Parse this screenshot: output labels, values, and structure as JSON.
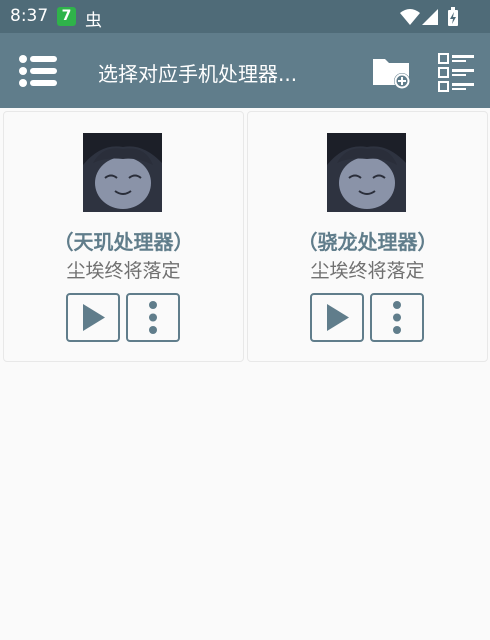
{
  "status_bar": {
    "time": "8:37",
    "badge_text": "7",
    "app_glyph": "虫",
    "icons": [
      "wifi-icon",
      "signal-icon",
      "battery-charging-icon"
    ]
  },
  "toolbar": {
    "title": "选择对应手机处理器...",
    "menu_icon": "menu-list-icon",
    "folder_icon": "folder-add-icon",
    "list_icon": "checklist-icon"
  },
  "cards": [
    {
      "title": "（天玑处理器）",
      "subtitle": "尘埃终将落定",
      "play_icon": "play-icon",
      "more_icon": "more-vertical-icon"
    },
    {
      "title": "（骁龙处理器）",
      "subtitle": "尘埃终将落定",
      "play_icon": "play-icon",
      "more_icon": "more-vertical-icon"
    }
  ],
  "colors": {
    "status_bar": "#4f6b78",
    "toolbar": "#607d8b",
    "accent": "#607d8b",
    "badge": "#2fb34a",
    "background": "#fafafa"
  }
}
